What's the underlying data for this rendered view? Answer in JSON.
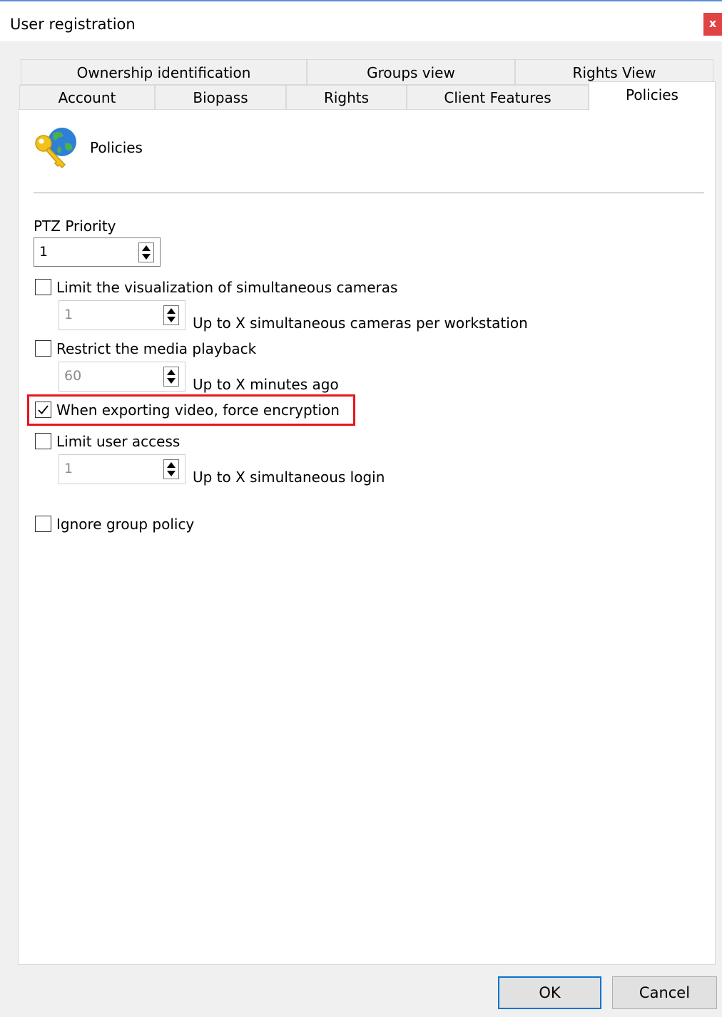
{
  "window": {
    "title": "User registration",
    "close_label": "x"
  },
  "tabs_row1": [
    {
      "label": "Ownership identification"
    },
    {
      "label": "Groups view"
    },
    {
      "label": "Rights View"
    }
  ],
  "tabs_row2": [
    {
      "label": "Account"
    },
    {
      "label": "Biopass"
    },
    {
      "label": "Rights"
    },
    {
      "label": "Client Features"
    },
    {
      "label": "Policies",
      "active": true
    }
  ],
  "header": {
    "label": "Policies",
    "icon": "policies-key-globe-icon"
  },
  "ptz": {
    "label": "PTZ Priority",
    "value": "1"
  },
  "limit_cameras": {
    "label": "Limit the visualization of simultaneous cameras",
    "checked": false,
    "value": "1",
    "suffix": "Up to X simultaneous cameras per workstation"
  },
  "restrict_playback": {
    "label": "Restrict the media playback",
    "checked": false,
    "value": "60",
    "suffix": "Up to X minutes ago"
  },
  "force_encryption": {
    "label": "When exporting video, force encryption",
    "checked": true
  },
  "limit_access": {
    "label": "Limit user access",
    "checked": false,
    "value": "1",
    "suffix": "Up to X simultaneous login"
  },
  "ignore_group": {
    "label": "Ignore group policy",
    "checked": false
  },
  "buttons": {
    "ok": "OK",
    "cancel": "Cancel"
  },
  "colors": {
    "highlight": "#e8151c",
    "primary_border": "#0a74d0",
    "close_bg": "#e04343"
  }
}
